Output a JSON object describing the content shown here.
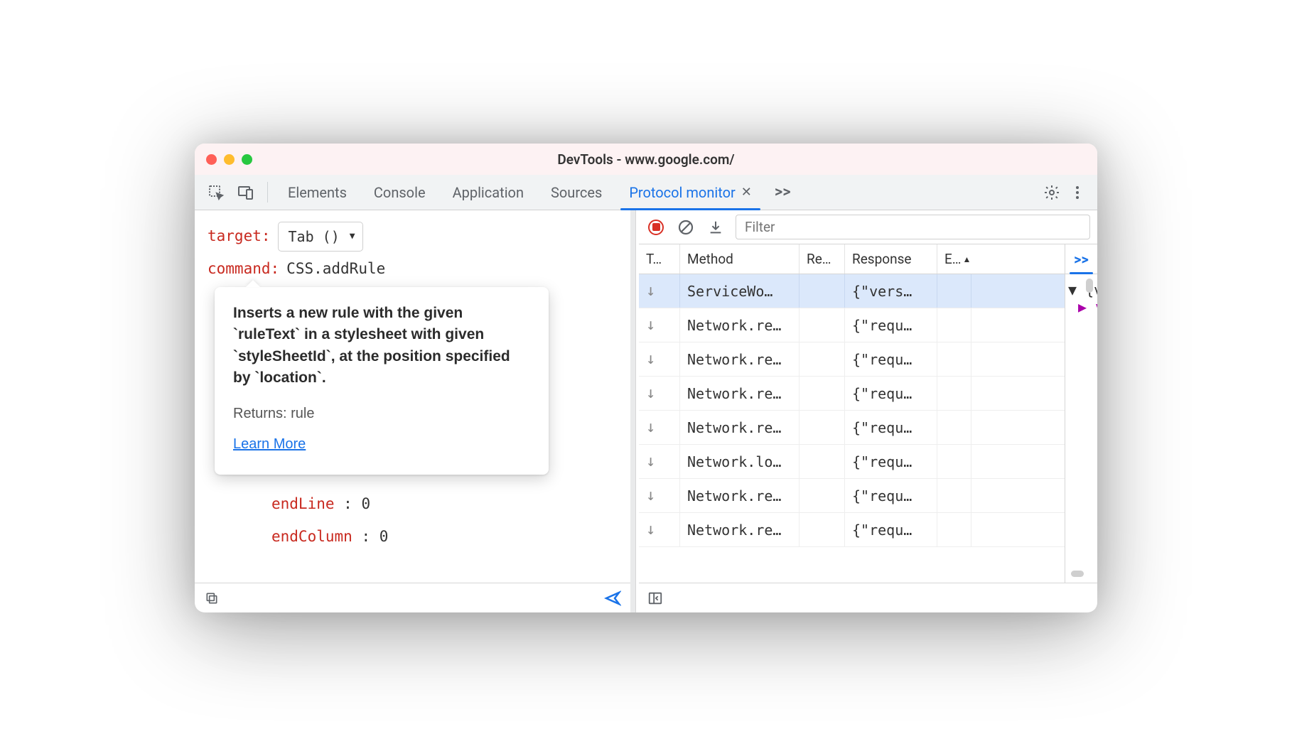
{
  "window": {
    "title": "DevTools - www.google.com/"
  },
  "tabs": {
    "items": [
      "Elements",
      "Console",
      "Application",
      "Sources",
      "Protocol monitor"
    ],
    "active": "Protocol monitor",
    "more": ">>"
  },
  "editor": {
    "target_label": "target",
    "target_value": "Tab ()",
    "command_label": "command",
    "command_value": "CSS.addRule",
    "params": [
      {
        "key": "endLine",
        "value": "0"
      },
      {
        "key": "endColumn",
        "value": "0"
      }
    ]
  },
  "tooltip": {
    "desc": "Inserts a new rule with the given `ruleText` in a stylesheet with given `styleSheetId`, at the position specified by `location`.",
    "returns": "Returns: rule",
    "learn": "Learn More"
  },
  "toolbar": {
    "filter_placeholder": "Filter"
  },
  "table": {
    "headers": {
      "c1": "T…",
      "c2": "Method",
      "c3": "Re…",
      "c4": "Response",
      "c5": "E…"
    },
    "rows": [
      {
        "dir": "↓",
        "method": "ServiceWo…",
        "re": "",
        "response": "{\"vers…",
        "selected": true
      },
      {
        "dir": "↓",
        "method": "Network.re…",
        "re": "",
        "response": "{\"requ…"
      },
      {
        "dir": "↓",
        "method": "Network.re…",
        "re": "",
        "response": "{\"requ…"
      },
      {
        "dir": "↓",
        "method": "Network.re…",
        "re": "",
        "response": "{\"requ…"
      },
      {
        "dir": "↓",
        "method": "Network.re…",
        "re": "",
        "response": "{\"requ…"
      },
      {
        "dir": "↓",
        "method": "Network.lo…",
        "re": "",
        "response": "{\"requ…"
      },
      {
        "dir": "↓",
        "method": "Network.re…",
        "re": "",
        "response": "{\"requ…"
      },
      {
        "dir": "↓",
        "method": "Network.re…",
        "re": "",
        "response": "{\"requ…"
      }
    ]
  },
  "side": {
    "more": ">>",
    "tree_l1": "▼ {vers",
    "tree_l2": "▶ ver"
  }
}
